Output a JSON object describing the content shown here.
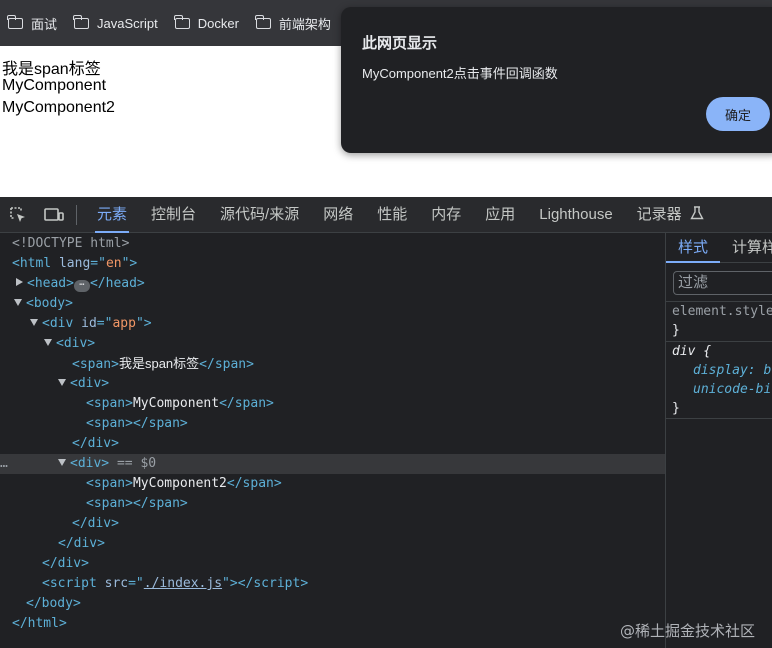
{
  "bookmarks": [
    {
      "label": "面试",
      "icon": "folder-icon"
    },
    {
      "label": "JavaScript",
      "icon": "folder-icon"
    },
    {
      "label": "Docker",
      "icon": "folder-icon"
    },
    {
      "label": "前端架构",
      "icon": "folder-icon"
    }
  ],
  "page": {
    "lines": [
      "我是span标签",
      "MyComponent",
      "MyComponent2"
    ]
  },
  "dialog": {
    "title": "此网页显示",
    "message": "MyComponent2点击事件回调函数",
    "ok_label": "确定"
  },
  "devtools": {
    "tabs": [
      "元素",
      "控制台",
      "源代码/来源",
      "网络",
      "性能",
      "内存",
      "应用",
      "Lighthouse",
      "记录器"
    ],
    "active_tab": "元素",
    "elements": {
      "doctype": "<!DOCTYPE html>",
      "html_lang": "en",
      "span1_text": "我是span标签",
      "span2_text": "MyComponent",
      "span3_text": "MyComponent2",
      "div_id": "app",
      "selected_marker": "== $0",
      "script_src": "./index.js",
      "ellipsis": "⋯",
      "gutter_dots": "…"
    },
    "styles_panel": {
      "tabs": [
        "样式",
        "计算样式"
      ],
      "filter_placeholder": "过滤",
      "element_style": "element.style {",
      "selector": "div {",
      "props": [
        "display: block;",
        "unicode-bidi: isolate;"
      ],
      "close_brace": "}"
    }
  },
  "watermark": "@稀土掘金技术社区",
  "colors": {
    "accent": "#7cacf8",
    "dialog_button": "#8ab4f8",
    "tag": "#5db0d7",
    "attr_value": "#f29766"
  }
}
